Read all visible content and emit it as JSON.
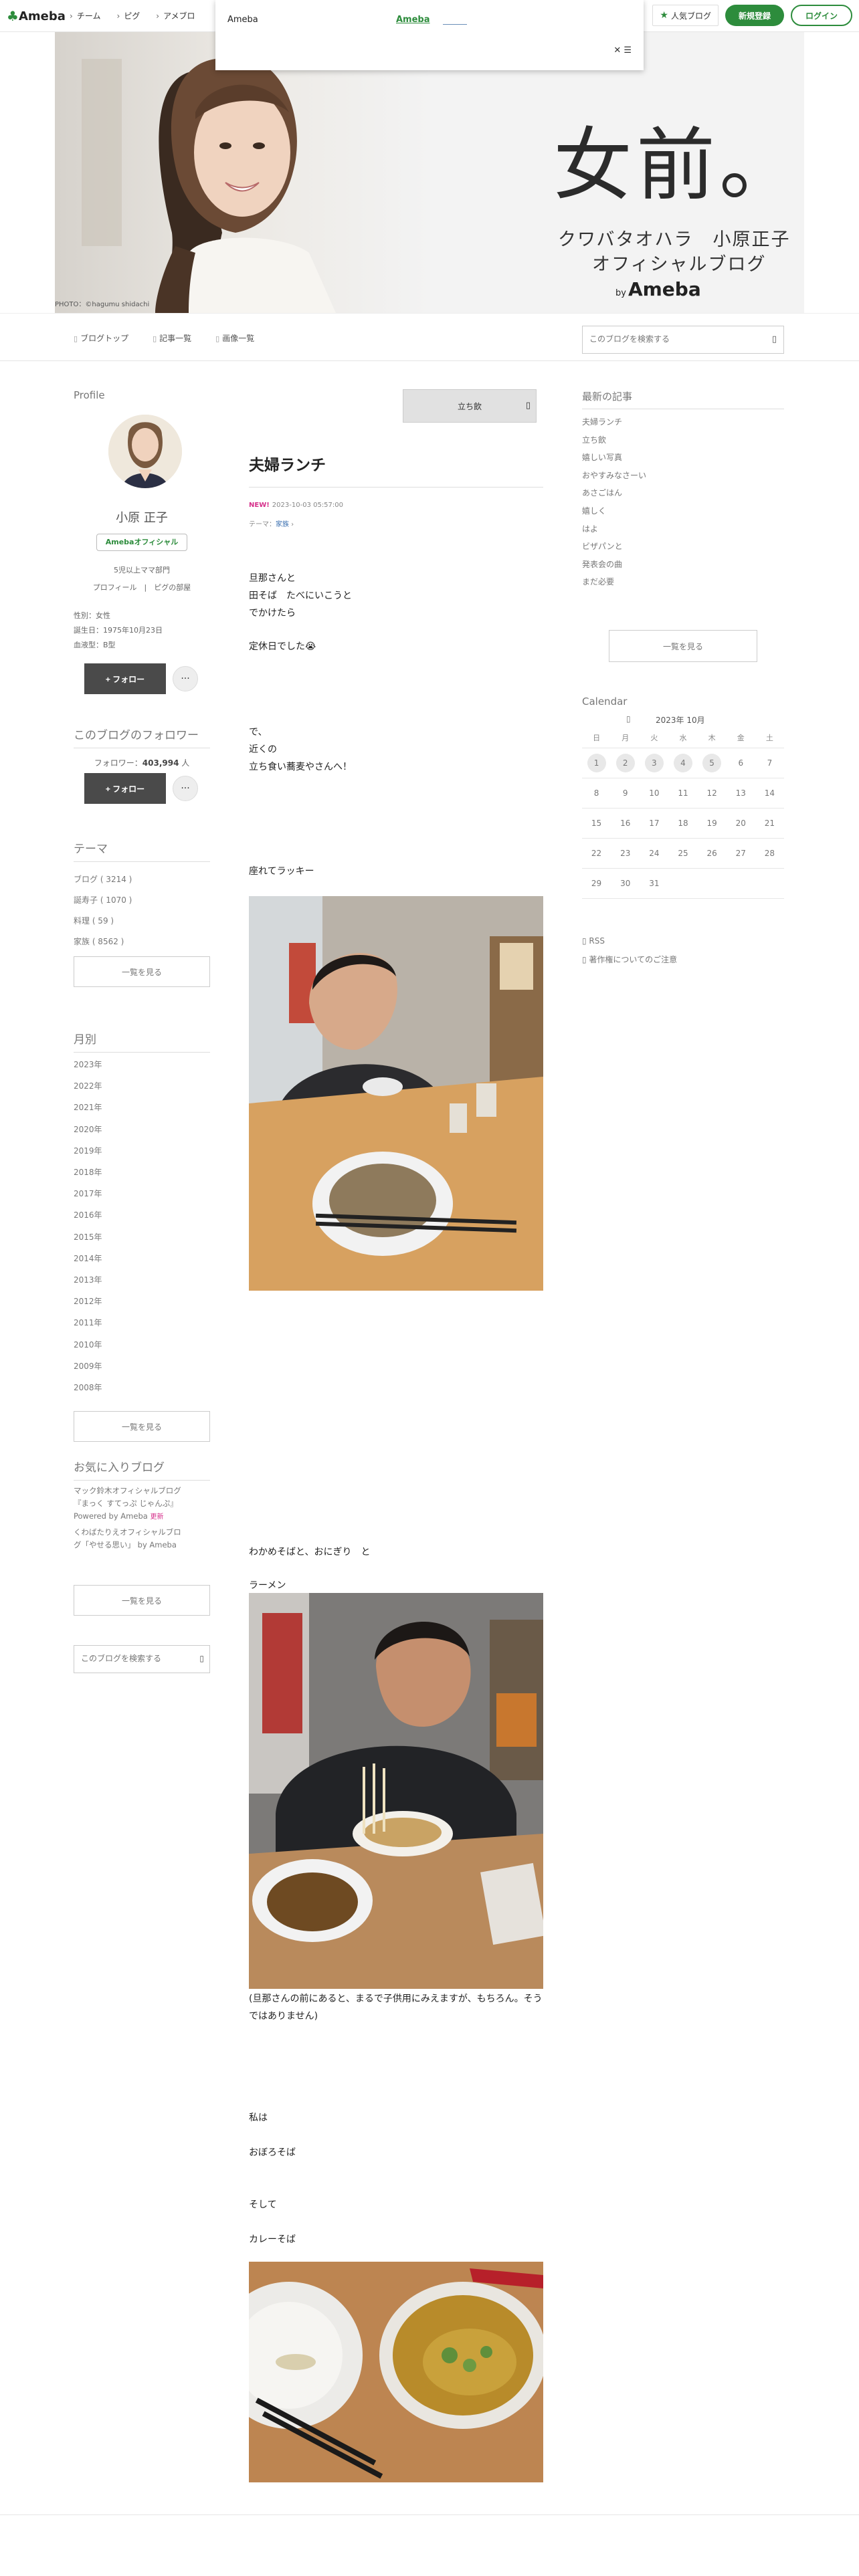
{
  "topbar": {
    "logo_text": "Ameba",
    "nav": [
      "チーム",
      "ピグ",
      "アメブロ"
    ],
    "popular_label": "人気ブログ",
    "signup_label": "新規登録",
    "login_label": "ログイン",
    "accent_color": "#2d8c3c"
  },
  "ad": {
    "title": "Ameba",
    "link": "Ameba",
    "close": "✕ ☰"
  },
  "banner": {
    "title": "女前。",
    "sub1": "クワバタオハラ　小原正子",
    "sub2": "オフィシャルブログ",
    "by_small": "by",
    "by_brand": "Ameba",
    "photo_credit": "PHOTO：©hagumu shidachi"
  },
  "blognav": {
    "items": [
      "ブログトップ",
      "記事一覧",
      "画像一覧"
    ],
    "search_placeholder": "このブログを検索する",
    "search_icon": "search-icon"
  },
  "profile": {
    "heading": "Profile",
    "name": "小原 正子",
    "badge": "Amebaオフィシャル",
    "rank": "5児以上ママ部門",
    "links": "プロフィール　|　ピグの部屋",
    "info": [
      "性別：女性",
      "誕生日：1975年10月23日",
      "血液型：B型"
    ],
    "follow_label": "+ フォロー",
    "more_label": "···"
  },
  "followers": {
    "heading": "このブログのフォロワー",
    "label": "フォロワー",
    "count": "403,994",
    "unit": "人",
    "follow_label": "+ フォロー",
    "more_label": "···"
  },
  "themes": {
    "heading": "テーマ",
    "items": [
      "ブログ ( 3214 )",
      "誕寿子 ( 1070 )",
      "料理 ( 59 )",
      "家族 ( 8562 )"
    ],
    "more_label": "一覧を見る"
  },
  "months": {
    "heading": "月別",
    "items": [
      "2023年",
      "2022年",
      "2021年",
      "2020年",
      "2019年",
      "2018年",
      "2017年",
      "2016年",
      "2015年",
      "2014年",
      "2013年",
      "2012年",
      "2011年",
      "2010年",
      "2009年",
      "2008年"
    ],
    "more_label": "一覧を見る"
  },
  "favorites": {
    "heading": "お気に入りブログ",
    "items": [
      "マック鈴木オフィシャルブログ",
      "『まっく すてっぷ じゃんぷ』",
      "Powered by Ameba",
      "くわばたりえオフィシャルブロ",
      "グ「やせる思い」 by Ameba"
    ],
    "new_label": "更新",
    "more_label": "一覧を見る",
    "search_placeholder": "このブログを検索する"
  },
  "article": {
    "stand_label": "立ち飲",
    "title": "夫婦ランチ",
    "new_label": "NEW!",
    "datetime": "2023-10-03 05:57:00",
    "theme_prefix": "テーマ：",
    "theme": "家族",
    "p1": [
      "旦那さんと",
      "田そば　たべにいこうと",
      "でかけたら"
    ],
    "p2": "定休日でした😭",
    "p3": [
      "で、",
      "近くの",
      "立ち食い蕎麦やさんへ！"
    ],
    "p4": "座れてラッキー",
    "p5": "わかめそばと、おにぎり　と",
    "p6": "ラーメン",
    "caption": "(旦那さんの前にあると、まるで子供用にみえますが、もちろん。そうではありません)",
    "p7": "私は",
    "p8": "おぼろそば",
    "p9": "そして",
    "p10": "カレーそば"
  },
  "recent": {
    "heading": "最新の記事",
    "items": [
      "夫婦ランチ",
      "立ち飲",
      "嬉しい写真",
      "おやすみなさーい",
      "あさごはん",
      "嬉しく",
      "はよ",
      "ビザパンと",
      "発表会の曲",
      "まだ必要"
    ],
    "more_label": "一覧を見る"
  },
  "calendar": {
    "heading": "Calendar",
    "year_month": "2023年 10月",
    "weekdays": [
      "日",
      "月",
      "火",
      "水",
      "木",
      "金",
      "土"
    ],
    "weeks": [
      [
        "1",
        "2",
        "3",
        "4",
        "5",
        "6",
        "7"
      ],
      [
        "8",
        "9",
        "10",
        "11",
        "12",
        "13",
        "14"
      ],
      [
        "15",
        "16",
        "17",
        "18",
        "19",
        "20",
        "21"
      ],
      [
        "22",
        "23",
        "24",
        "25",
        "26",
        "27",
        "28"
      ],
      [
        "29",
        "30",
        "31",
        "",
        "",
        "",
        ""
      ]
    ],
    "highlighted": [
      "1",
      "2",
      "3",
      "4",
      "5"
    ]
  },
  "rss": "RSS",
  "copyright_note": "著作権についてのご注意"
}
